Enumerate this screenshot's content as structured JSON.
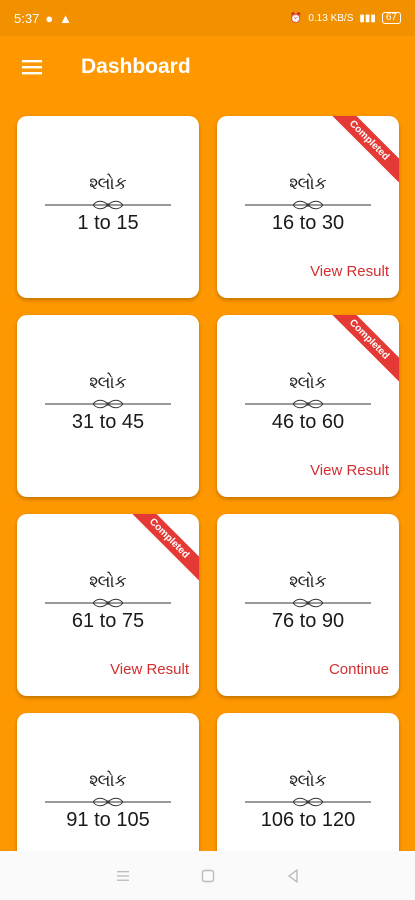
{
  "status_bar": {
    "time": "5:37",
    "net_speed": "0.13 KB/S",
    "battery": "67"
  },
  "app_bar": {
    "title": "Dashboard"
  },
  "cards": [
    {
      "label": "શ્લોક",
      "range": "1 to 15",
      "completed": false,
      "action": ""
    },
    {
      "label": "શ્લોક",
      "range": "16 to 30",
      "completed": true,
      "action": "View Result"
    },
    {
      "label": "શ્લોક",
      "range": "31 to 45",
      "completed": false,
      "action": ""
    },
    {
      "label": "શ્લોક",
      "range": "46 to 60",
      "completed": true,
      "action": "View Result"
    },
    {
      "label": "શ્લોક",
      "range": "61 to 75",
      "completed": true,
      "action": "View Result"
    },
    {
      "label": "શ્લોક",
      "range": "76 to 90",
      "completed": false,
      "action": "Continue"
    },
    {
      "label": "શ્લોક",
      "range": "91 to 105",
      "completed": false,
      "action": ""
    },
    {
      "label": "શ્લોક",
      "range": "106 to 120",
      "completed": false,
      "action": ""
    }
  ],
  "ribbon_text": "Completed",
  "colors": {
    "primary": "#ff9800",
    "action": "#d32f2f",
    "ribbon": "#e53935"
  }
}
